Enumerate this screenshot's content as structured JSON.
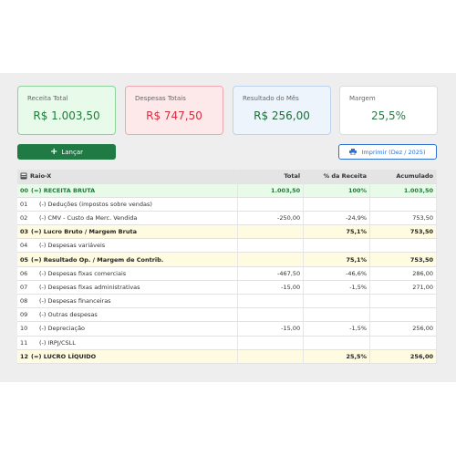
{
  "cards": [
    {
      "label": "Receita Total",
      "value": "R$ 1.003,50"
    },
    {
      "label": "Despesas Totais",
      "value": "R$ 747,50"
    },
    {
      "label": "Resultado do Mês",
      "value": "R$ 256,00"
    },
    {
      "label": "Margem",
      "value": "25,5%"
    }
  ],
  "buttons": {
    "add_label": "Lançar",
    "print_label": "Imprimir (Dez / 2025)"
  },
  "table": {
    "headers": {
      "desc": "Raio-X",
      "total": "Total",
      "perc": "% da Receita",
      "acc": "Acumulado"
    },
    "rows": [
      {
        "code": "00",
        "desc": "(=) RECEITA BRUTA",
        "total": "1.003,50",
        "perc": "100%",
        "acc": "1.003,50",
        "style": "green"
      },
      {
        "code": "01",
        "desc": "(-) Deduções (impostos sobre vendas)",
        "total": "",
        "perc": "",
        "acc": "",
        "style": ""
      },
      {
        "code": "02",
        "desc": "(-) CMV - Custo da Merc. Vendida",
        "total": "-250,00",
        "perc": "-24,9%",
        "acc": "753,50",
        "style": ""
      },
      {
        "code": "03",
        "desc": "(=) Lucro Bruto / Margem Bruta",
        "total": "",
        "perc": "75,1%",
        "acc": "753,50",
        "style": "yellow"
      },
      {
        "code": "04",
        "desc": "(-) Despesas variáveis",
        "total": "",
        "perc": "",
        "acc": "",
        "style": ""
      },
      {
        "code": "05",
        "desc": "(=) Resultado Op. / Margem de Contrib.",
        "total": "",
        "perc": "75,1%",
        "acc": "753,50",
        "style": "yellow"
      },
      {
        "code": "06",
        "desc": "(-) Despesas fixas comerciais",
        "total": "-467,50",
        "perc": "-46,6%",
        "acc": "286,00",
        "style": ""
      },
      {
        "code": "07",
        "desc": "(-) Despesas fixas administrativas",
        "total": "-15,00",
        "perc": "-1,5%",
        "acc": "271,00",
        "style": ""
      },
      {
        "code": "08",
        "desc": "(-) Despesas financeiras",
        "total": "",
        "perc": "",
        "acc": "",
        "style": ""
      },
      {
        "code": "09",
        "desc": "(-) Outras despesas",
        "total": "",
        "perc": "",
        "acc": "",
        "style": ""
      },
      {
        "code": "10",
        "desc": "(-) Depreciação",
        "total": "-15,00",
        "perc": "-1,5%",
        "acc": "256,00",
        "style": ""
      },
      {
        "code": "11",
        "desc": "(-) IRPJ/CSLL",
        "total": "",
        "perc": "",
        "acc": "",
        "style": ""
      },
      {
        "code": "12",
        "desc": "(=) LUCRO LÍQUIDO",
        "total": "",
        "perc": "25,5%",
        "acc": "256,00",
        "style": "yellow"
      }
    ]
  }
}
